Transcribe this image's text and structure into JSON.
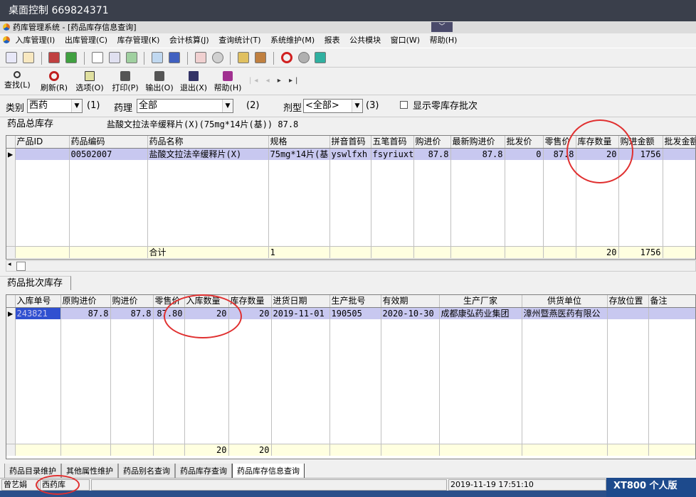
{
  "remote_title": "桌面控制 669824371",
  "window": {
    "title": "药库管理系统 - [药品库存信息查询]"
  },
  "menu": [
    "入库管理(I)",
    "出库管理(C)",
    "库存管理(K)",
    "会计核算(J)",
    "查询统计(T)",
    "系统维护(M)",
    "报表",
    "公共模块",
    "窗口(W)",
    "帮助(H)"
  ],
  "actions": {
    "find": "查找(L)",
    "refresh": "刷新(R)",
    "options": "选项(O)",
    "print": "打印(P)",
    "export": "输出(O)",
    "exit": "退出(X)",
    "help": "帮助(H)"
  },
  "filters": {
    "category_label": "类别",
    "category_value": "西药",
    "category_key": "(1)",
    "pharm_label": "药理",
    "pharm_value": "全部",
    "pharm_key": "(2)",
    "form_label": "剂型",
    "form_value": "<全部>",
    "form_key": "(3)",
    "zero_stock_label": "显示零库存批次"
  },
  "summary": {
    "title": "药品总库存",
    "selected_drug": "盐酸文拉法辛缓释片(X)(75mg*14片(基)) 87.8",
    "columns": [
      "产品ID",
      "药品编码",
      "药品名称",
      "规格",
      "拼音首码",
      "五笔首码",
      "购进价",
      "最新购进价",
      "批发价",
      "零售价",
      "库存数量",
      "购进金额",
      "批发金额"
    ],
    "rows": [
      [
        "",
        "00502007",
        "盐酸文拉法辛缓释片(X)",
        "75mg*14片(基",
        "yswlfxh",
        "fsyriuxt",
        "87.8",
        "87.8",
        "0",
        "87.8",
        "20",
        "1756",
        ""
      ]
    ],
    "footer": [
      "",
      "",
      "合计",
      "1",
      "",
      "",
      "",
      "",
      "",
      "",
      "20",
      "1756",
      ""
    ]
  },
  "batch": {
    "title": "药品批次库存",
    "columns": [
      "入库单号",
      "原购进价",
      "购进价",
      "零售价",
      "入库数量",
      "库存数量",
      "进货日期",
      "生产批号",
      "有效期",
      "生产厂家",
      "供货单位",
      "存放位置",
      "备注"
    ],
    "rows": [
      [
        "243821",
        "87.8",
        "87.8",
        "87.80",
        "20",
        "20",
        "2019-11-01",
        "190505",
        "2020-10-30",
        "成都康弘药业集团",
        "漳州暨燕医药有限公",
        "",
        ""
      ]
    ],
    "footer": [
      "",
      "",
      "",
      "",
      "20",
      "20",
      "",
      "",
      "",
      "",
      "",
      "",
      ""
    ]
  },
  "tabs": [
    "药品目录维护",
    "其他属性维护",
    "药品别名查询",
    "药品库存查询",
    "药品库存信息查询"
  ],
  "status": {
    "user": "曾艺娟",
    "store": "西药库",
    "datetime": "2019-11-19 17:51:10",
    "edition": "XT800 个人版"
  },
  "annotation_color": "#e03030"
}
